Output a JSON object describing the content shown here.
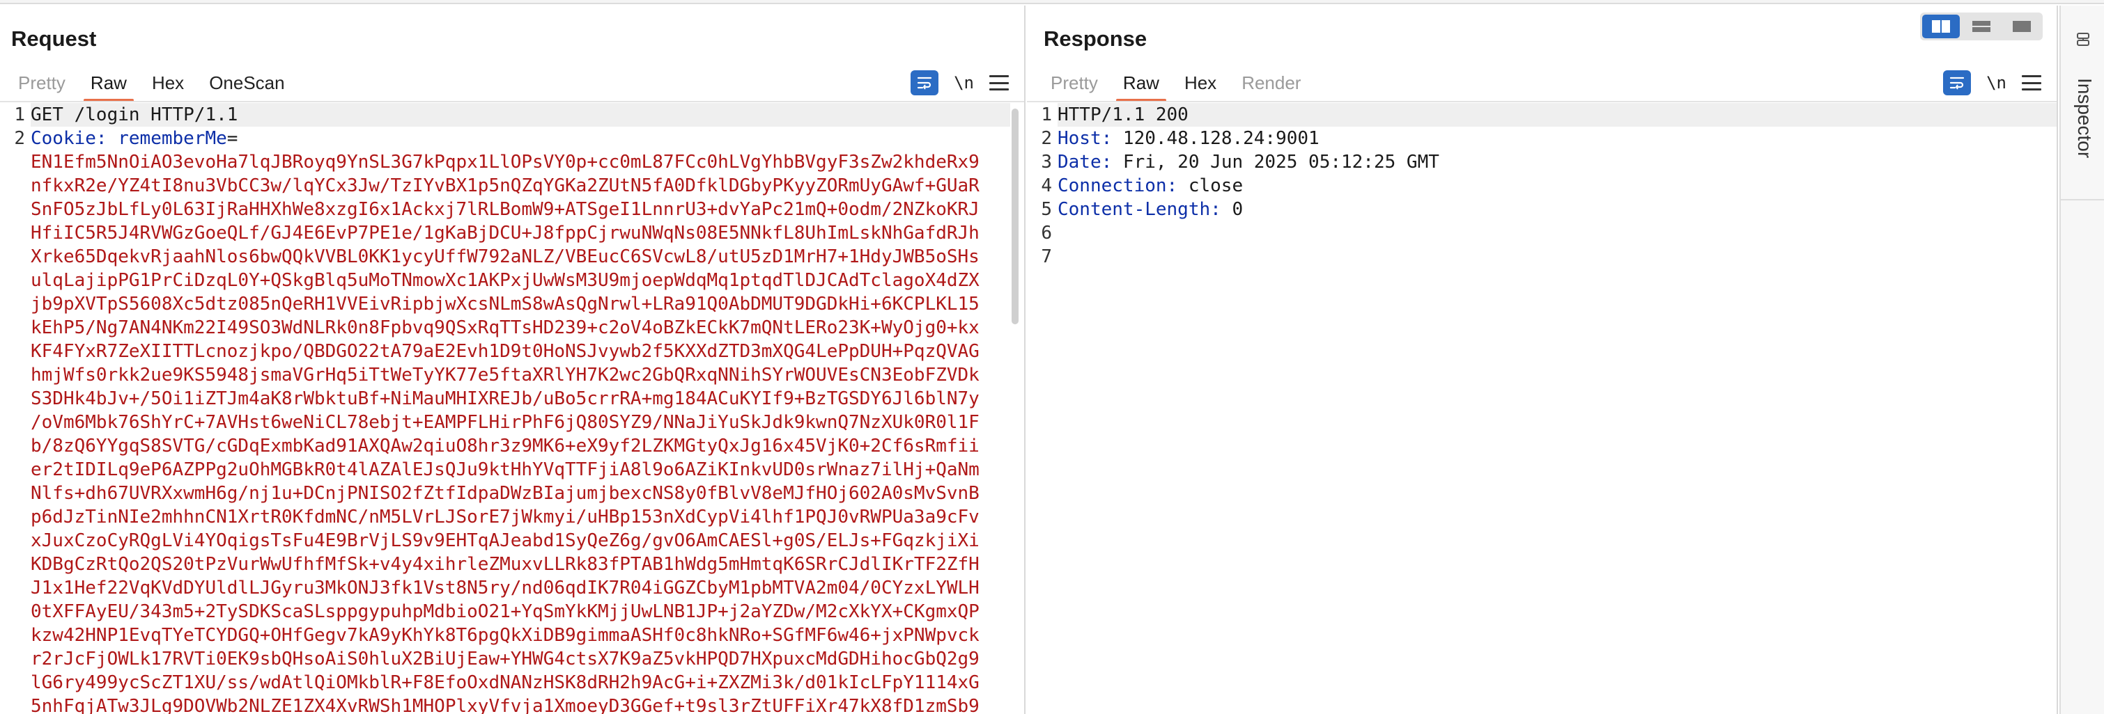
{
  "request": {
    "title": "Request",
    "tabs": [
      "Pretty",
      "Raw",
      "Hex",
      "OneScan"
    ],
    "line1": "GET /login HTTP/1.1",
    "cookie_key": "Cookie:",
    "cookie_name": "rememberMe",
    "cookie_eq": "=",
    "cookie_value_lines": [
      "EN1Efm5NnOiAO3evoHa7lqJBRoyq9YnSL3G7kPqpx1LlOPsVY0p+cc0mL87FCc0hLVgYhbBVgyF3sZw2khdeRx9",
      "nfkxR2e/YZ4tI8nu3VbCC3w/lqYCx3Jw/TzIYvBX1p5nQZqYGKa2ZUtN5fA0DfklDGbyPKyyZORmUyGAwf+GUaR",
      "SnFO5zJbLfLy0L63IjRaHHXhWe8xzgI6x1Ackxj7lRLBomW9+ATSgeI1LnnrU3+dvYaPc21mQ+0odm/2NZkoKRJ",
      "HfiIC5R5J4RVWGzGoeQLf/GJ4E6EvP7PE1e/1gKaBjDCU+J8fppCjrwuNWqNs08E5NNkfL8UhImLskNhGafdRJh",
      "Xrke65DqekvRjaahNlos6bwQQkVVBL0KK1ycyUffW792aNLZ/VBEucC6SVcwL8/utU5zD1MrH7+1HdyJWB5oSHs",
      "ulqLajipPG1PrCiDzqL0Y+QSkgBlq5uMoTNmowXc1AKPxjUwWsM3U9mjoepWdqMq1ptqdTlDJCAdTclagoX4dZX",
      "jb9pXVTpS5608Xc5dtz085nQeRH1VVEivRipbjwXcsNLmS8wAsQgNrwl+LRa91Q0AbDMUT9DGDkHi+6KCPLKL15",
      "kEhP5/Ng7AN4NKm22I49SO3WdNLRk0n8Fpbvq9QSxRqTTsHD239+c2oV4oBZkECkK7mQNtLERo23K+WyOjg0+kx",
      "KF4FYxR7ZeXIITTLcnozjkpo/QBDGO22tA79aE2Evh1D9t0HoNSJvywb2f5KXXdZTD3mXQG4LePpDUH+PqzQVAG",
      "hmjWfs0rkk2ue9KS5948jsmaVGrHq5iTtWeTyYK77e5ftaXRlYH7K2wc2GbQRxqNNihSYrWOUVEsCN3EobFZVDk",
      "S3DHk4bJv+/5Oi1iZTJm4aK8rWbktuBf+NiMauMHIXREJb/uBo5crrRA+mg184ACuKYIf9+BzTGSDY6Jl6blN7y",
      "/oVm6Mbk76ShYrC+7AVHst6weNiCL78ebjt+EAMPFLHirPhF6jQ80SYZ9/NNaJiYuSkJdk9kwnQ7NzXUk0R0l1F",
      "b/8zQ6YYgqS8SVTG/cGDqExmbKad91AXQAw2qiuO8hr3z9MK6+eX9yf2LZKMGtyQxJg16x45VjK0+2Cf6sRmfii",
      "er2tIDILq9eP6AZPPg2uOhMGBkR0t4lAZAlEJsQJu9ktHhYVqTTFjiA8l9o6AZiKInkvUD0srWnaz7ilHj+QaNm",
      "Nlfs+dh67UVRXxwmH6g/nj1u+DCnjPNISO2fZtfIdpaDWzBIajumjbexcNS8y0fBlvV8eMJfHOj602A0sMvSvnB",
      "p6dJzTinNIe2mhhnCN1XrtR0KfdmNC/nM5LVrLJSorE7jWkmyi/uHBp153nXdCypVi4lhf1PQJ0vRWPUa3a9cFv",
      "xJuxCzoCyRQgLVi4YOqigsTsFu4E9BrVjLS9v9EHTqAJeabd1SyQeZ6g/gvO6AmCAESl+g0S/ELJs+FGqzkjiXi",
      "KDBgCzRtQo2QS20tPzVurWwUfhfMfSk+v4y4xihrleZMuxvLLRk83fPTAB1hWdg5mHmtqK6SRrCJdlIKrTF2ZfH",
      "J1x1Hef22VqKVdDYUldlLJGyru3MkONJ3fk1Vst8N5ry/nd06qdIK7R04iGGZCbyM1pbMTVA2m04/0CYzxLYWLH",
      "0tXFFAyEU/343m5+2TySDKScaSLsppgypuhpMdbioO21+YqSmYkKMjjUwLNB1JP+j2aYZDw/M2cXkYX+CKgmxQP",
      "kzw42HNP1EvqTYeTCYDGQ+OHfGegv7kA9yKhYk8T6pgQkXiDB9gimmaASHf0c8hkNRo+SGfMF6w46+jxPNWpvck",
      "r2rJcFjOWLk17RVTi0EK9sbQHsoAiS0hluX2BiUjEaw+YHWG4ctsX7K9aZ5vkHPQD7HXpuxcMdGDHihocGbQ2g9",
      "lG6ry499ycScZT1XU/ss/wdAtlQiOMkblR+F8EfoOxdNANzHSK8dRH2h9AcG+i+ZXZMi3k/d01kIcLFpY1114xG",
      "5nhFqjATw3JLg9DOVWb2NLZE1ZX4XvRWSh1MHOPlxyVfvja1XmoeyD3GGef+t9sl3rZtUFFiXr47kX8fD1zmSb9"
    ]
  },
  "response": {
    "title": "Response",
    "tabs": [
      "Pretty",
      "Raw",
      "Hex",
      "Render"
    ],
    "lines": [
      {
        "key": "HTTP/1.1 200",
        "val": ""
      },
      {
        "key": "Host:",
        "val": " 120.48.128.24:9001"
      },
      {
        "key": "Date:",
        "val": " Fri, 20 Jun 2025 05:12:25 GMT"
      },
      {
        "key": "Connection:",
        "val": " close"
      },
      {
        "key": "Content-Length:",
        "val": " 0"
      },
      {
        "key": "",
        "val": ""
      },
      {
        "key": "",
        "val": ""
      }
    ]
  },
  "tools": {
    "newline": "\\n"
  },
  "inspector": {
    "label": "Inspector"
  },
  "colors": {
    "accent": "#e8704a",
    "blue": "#2b6cc4",
    "cookie_value": "#b01818",
    "key": "#0d2fa8"
  }
}
